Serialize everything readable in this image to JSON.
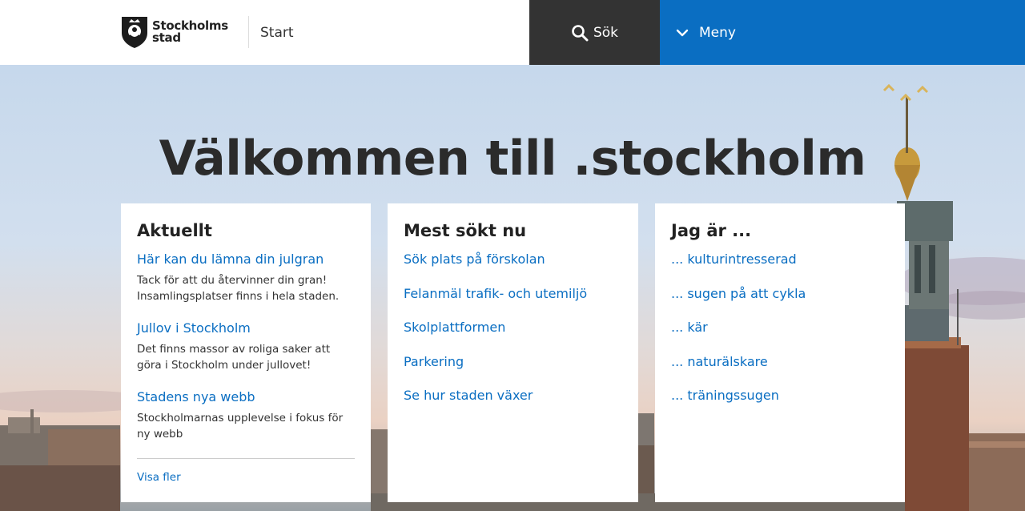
{
  "header": {
    "logo_line1": "Stockholms",
    "logo_line2": "stad",
    "start_label": "Start",
    "search_label": "Sök",
    "menu_label": "Meny"
  },
  "hero": {
    "title": "Välkommen till .stockholm"
  },
  "aktuellt": {
    "title": "Aktuellt",
    "items": [
      {
        "title": "Här kan du lämna din julgran",
        "desc": "Tack för att du återvinner din gran! Insamlingsplatser finns i hela staden."
      },
      {
        "title": "Jullov i Stockholm",
        "desc": "Det finns massor av roliga saker att göra i Stockholm under jullovet!"
      },
      {
        "title": "Stadens nya webb",
        "desc": "Stockholmarnas upplevelse i fokus för ny webb"
      }
    ],
    "more_label": "Visa fler"
  },
  "mest_sokt": {
    "title": "Mest sökt nu",
    "items": [
      "Sök plats på förskolan",
      "Felanmäl trafik- och utemiljö",
      "Skolplattformen",
      "Parkering",
      "Se hur staden växer"
    ]
  },
  "jag_ar": {
    "title": "Jag är ...",
    "items": [
      "... kulturintresserad",
      "... sugen på att cykla",
      "... kär",
      "... naturälskare",
      "... träningssugen"
    ]
  },
  "colors": {
    "link": "#0a6ec2",
    "search_bg": "#333333",
    "menu_bg": "#0a6ec2"
  }
}
